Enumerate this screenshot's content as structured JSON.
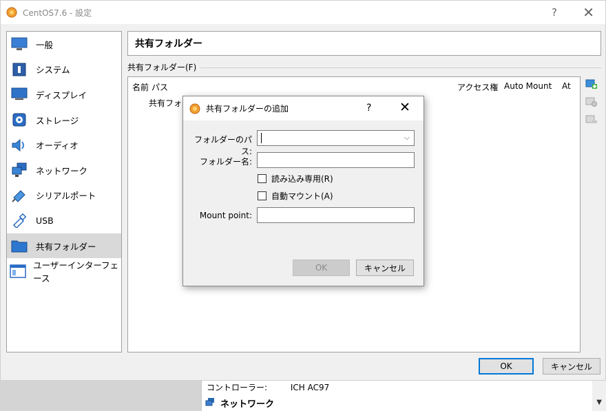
{
  "window": {
    "title": "CentOS7.6 - 設定",
    "help_symbol": "?",
    "close_symbol": "✕"
  },
  "sidebar": {
    "items": [
      {
        "label": "一般",
        "icon": "monitor-icon",
        "selected": false
      },
      {
        "label": "システム",
        "icon": "chip-icon",
        "selected": false
      },
      {
        "label": "ディスプレイ",
        "icon": "display-icon",
        "selected": false
      },
      {
        "label": "ストレージ",
        "icon": "disk-icon",
        "selected": false
      },
      {
        "label": "オーディオ",
        "icon": "speaker-icon",
        "selected": false
      },
      {
        "label": "ネットワーク",
        "icon": "network-icon",
        "selected": false
      },
      {
        "label": "シリアルポート",
        "icon": "serial-port-icon",
        "selected": false
      },
      {
        "label": "USB",
        "icon": "usb-icon",
        "selected": false
      },
      {
        "label": "共有フォルダー",
        "icon": "folder-icon",
        "selected": true
      },
      {
        "label": "ユーザーインターフェース",
        "icon": "ui-window-icon",
        "selected": false
      }
    ]
  },
  "content": {
    "section_title": "共有フォルダー",
    "group_label": "共有フォルダー(F)",
    "table": {
      "columns": [
        "名前",
        "パス",
        "アクセス権",
        "Auto Mount",
        "At"
      ],
      "row_text": "共有フォル"
    },
    "tools": [
      "add-folder-icon",
      "edit-folder-icon",
      "remove-folder-icon"
    ]
  },
  "footer": {
    "ok_label": "OK",
    "cancel_label": "キャンセル"
  },
  "background_panel": {
    "controller_label": "コントローラー:",
    "controller_value": "ICH AC97",
    "network_label": "ネットワーク"
  },
  "dialog": {
    "title": "共有フォルダーの追加",
    "help_symbol": "?",
    "close_symbol": "✕",
    "folder_path_label": "フォルダーのパス:",
    "folder_path_value": "",
    "folder_name_label": "フォルダー名:",
    "folder_name_value": "",
    "read_only_label": "読み込み専用(R)",
    "read_only_checked": false,
    "auto_mount_label": "自動マウント(A)",
    "auto_mount_checked": false,
    "mount_point_label": "Mount point:",
    "mount_point_value": "",
    "ok_label": "OK",
    "cancel_label": "キャンセル"
  },
  "colors": {
    "accent": "#0078d7",
    "selected_bg": "#d9d9d9",
    "window_bg": "#f0f0f0"
  }
}
